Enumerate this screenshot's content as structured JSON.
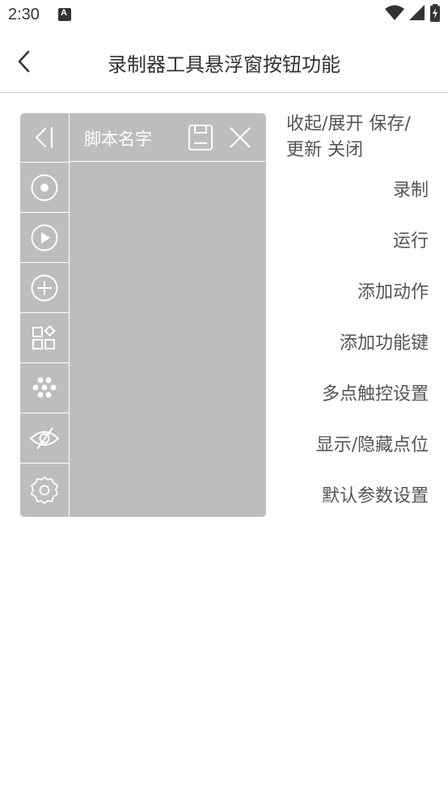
{
  "status_bar": {
    "time": "2:30",
    "icons": [
      "notification-a-icon",
      "wifi-icon",
      "signal-icon",
      "battery-charging-icon"
    ]
  },
  "header": {
    "title": "录制器工具悬浮窗按钮功能",
    "back_icon": "chevron-left-icon"
  },
  "panel": {
    "script_name": "脚本名字",
    "save_icon": "save-icon",
    "close_icon": "close-icon",
    "background_color": "#bdbdbd",
    "side_buttons": [
      {
        "icon": "collapse-icon"
      },
      {
        "icon": "record-icon"
      },
      {
        "icon": "play-icon"
      },
      {
        "icon": "add-circle-icon"
      },
      {
        "icon": "function-keys-icon"
      },
      {
        "icon": "multi-touch-icon"
      },
      {
        "icon": "eye-hidden-icon"
      },
      {
        "icon": "settings-gear-icon"
      }
    ]
  },
  "legend": {
    "collapse_save_close_line1": "收起/展开 保存/",
    "collapse_save_close_line2": "更新 关闭",
    "record": "录制",
    "run": "运行",
    "add_action": "添加动作",
    "add_function_key": "添加功能键",
    "multi_touch_settings": "多点触控设置",
    "show_hide_points": "显示/隐藏点位",
    "default_param_settings": "默认参数设置"
  }
}
